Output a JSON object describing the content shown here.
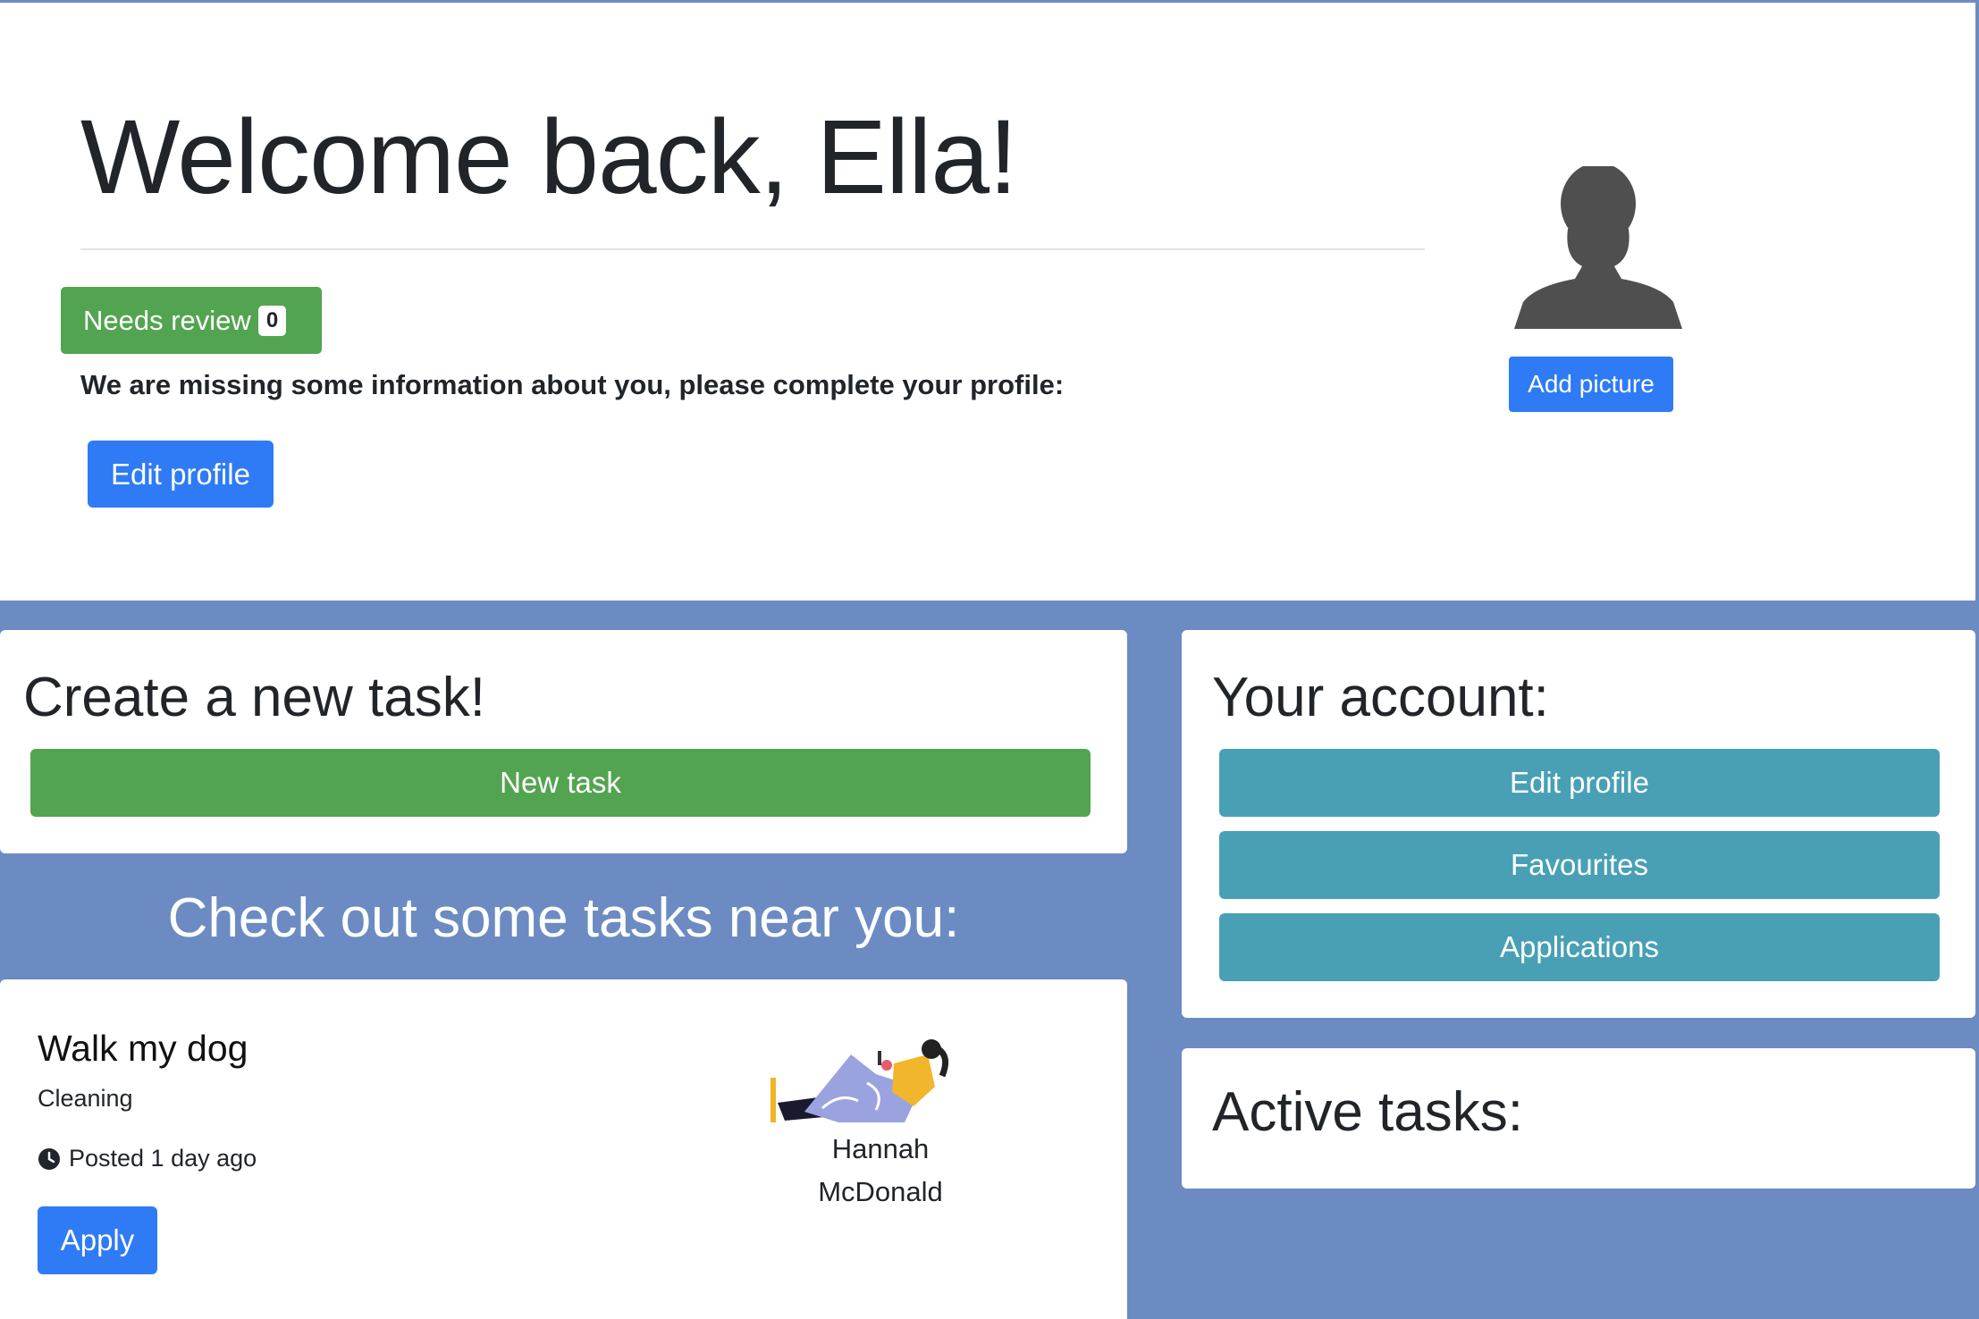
{
  "hero": {
    "welcome": "Welcome back, Ella!",
    "badge_label": "Needs review",
    "badge_count": "0",
    "missing_info": "We are missing some information about you, please complete your profile:",
    "edit_profile": "Edit profile",
    "add_picture": "Add picture",
    "avatar_icon": "user-silhouette-icon"
  },
  "create_task": {
    "title": "Create a new task!",
    "button": "New task"
  },
  "nearby": {
    "heading": "Check out some tasks near you:",
    "tasks": [
      {
        "title": "Walk my dog",
        "category": "Cleaning",
        "posted": "Posted 1 day ago",
        "apply": "Apply",
        "poster_first": "Hannah",
        "poster_last": "McDonald",
        "posted_icon": "clock-icon"
      }
    ]
  },
  "account": {
    "title": "Your account:",
    "buttons": [
      "Edit profile",
      "Favourites",
      "Applications"
    ]
  },
  "active_tasks": {
    "title": "Active tasks:"
  },
  "colors": {
    "background": "#6c8bc2",
    "primary": "#2f7bf5",
    "success": "#53a451",
    "info": "#49a0b5"
  }
}
